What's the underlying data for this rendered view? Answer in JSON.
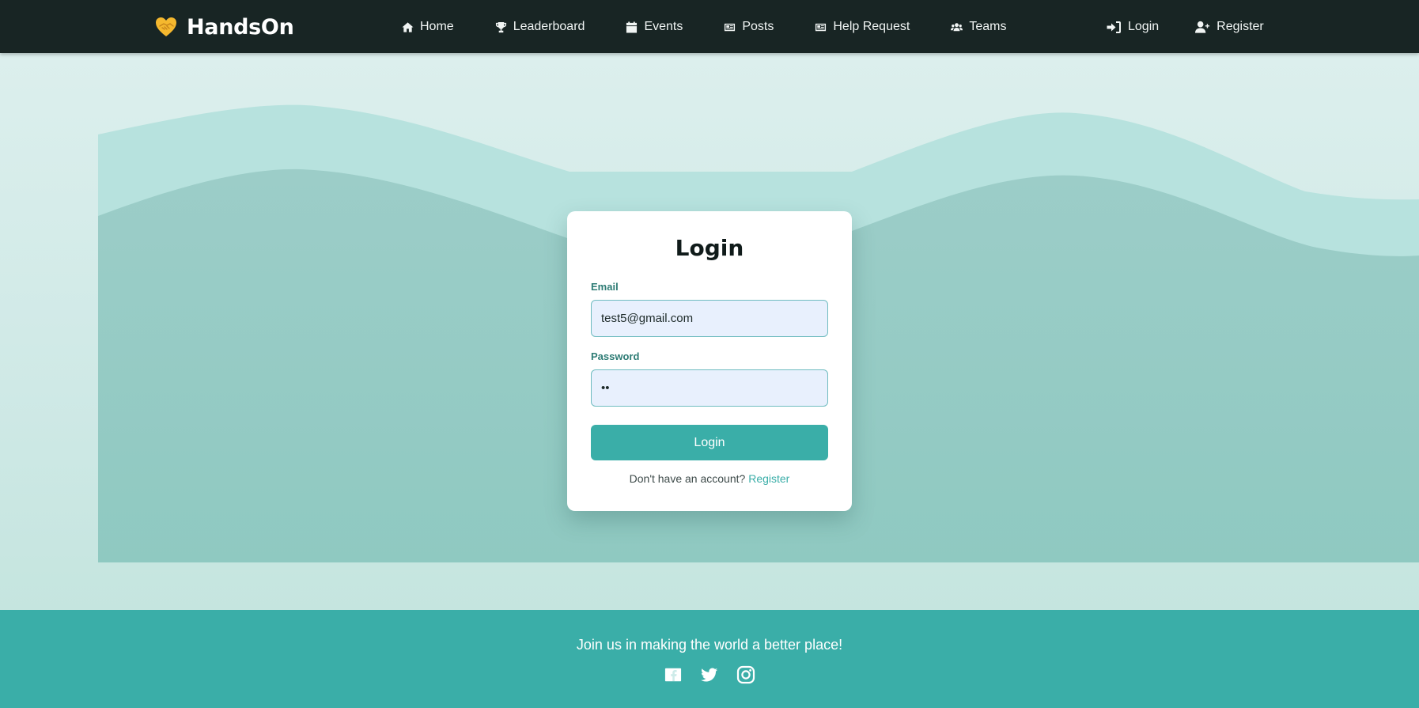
{
  "brand": {
    "name": "HandsOn",
    "logo_icon": "handshake-heart-icon",
    "accent": "#f5b82e"
  },
  "nav": {
    "items": [
      {
        "label": "Home",
        "icon": "home-icon"
      },
      {
        "label": "Leaderboard",
        "icon": "trophy-icon"
      },
      {
        "label": "Events",
        "icon": "calendar-icon"
      },
      {
        "label": "Posts",
        "icon": "newspaper-icon"
      },
      {
        "label": "Help Request",
        "icon": "newspaper-icon"
      },
      {
        "label": "Teams",
        "icon": "users-icon"
      }
    ],
    "auth": [
      {
        "label": "Login",
        "icon": "sign-in-icon"
      },
      {
        "label": "Register",
        "icon": "user-plus-icon"
      }
    ]
  },
  "login": {
    "title": "Login",
    "email_label": "Email",
    "email_value": "test5@gmail.com",
    "password_label": "Password",
    "password_value": "••",
    "submit_label": "Login",
    "no_account_text": "Don't have an account?",
    "register_link": "Register"
  },
  "footer": {
    "tagline": "Join us in making the world a better place!",
    "social": [
      "facebook-icon",
      "twitter-icon",
      "instagram-icon"
    ]
  },
  "colors": {
    "navbar": "#182524",
    "primary": "#3aaea8",
    "wave_light": "#b7e2de",
    "wave_dark": "#97cbc5"
  }
}
